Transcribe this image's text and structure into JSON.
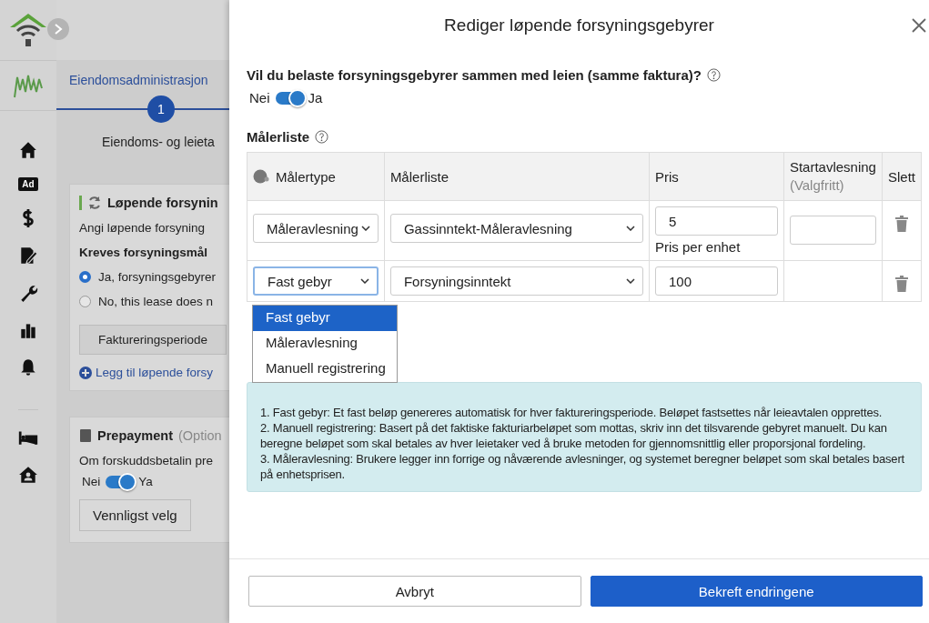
{
  "sidebar": {
    "items": [
      {
        "kind": "home"
      },
      {
        "kind": "ad",
        "label": "Ad"
      },
      {
        "kind": "dollar"
      },
      {
        "kind": "edit"
      },
      {
        "kind": "wrench"
      },
      {
        "kind": "chart"
      },
      {
        "kind": "bell"
      },
      {
        "kind": "bed"
      },
      {
        "kind": "house"
      }
    ]
  },
  "background": {
    "breadcrumb": "Eiendomsadministrasjon",
    "step_number": "1",
    "step_label": "Eiendoms- og leieta",
    "card_title": "Løpende forsynin",
    "card_intro": "Angi løpende forsyning",
    "question": "Kreves forsyningsmål",
    "options": [
      {
        "label": "Ja, forsyningsgebyrer",
        "selected": true
      },
      {
        "label": "No, this lease does n",
        "selected": false
      }
    ],
    "period_button": "Faktureringsperiode",
    "add_link": "Legg til løpende forsy",
    "prepay_title": "Prepayment",
    "prepay_optional": "(Option",
    "prepay_question": "Om forskuddsbetalin pre",
    "prepay_toggle": {
      "off_label": "Nei",
      "on_label": "Ya",
      "on": true
    },
    "prepay_select": "Vennligst velg"
  },
  "dialog": {
    "title": "Rediger løpende forsyningsgebyrer",
    "question": "Vil du belaste forsyningsgebyrer sammen med leien (samme faktura)?",
    "toggle": {
      "off_label": "Nei",
      "on_label": "Ja",
      "on": true
    },
    "list_title": "Målerliste",
    "columns": [
      "Målertype",
      "Målerliste",
      "Pris",
      "Startavlesning",
      "Slett"
    ],
    "column_note": "(Valgfritt)",
    "rows": [
      {
        "type": "Måleravlesning",
        "meter": "Gassinntekt-Måleravlesning",
        "price": "5",
        "price_note": "Pris per enhet",
        "focused": false
      },
      {
        "type": "Fast gebyr",
        "meter": "Forsyningsinntekt",
        "price": "100",
        "focused": true
      }
    ],
    "dropdown": [
      {
        "label": "Fast gebyr",
        "selected": true
      },
      {
        "label": "Måleravlesning",
        "selected": false
      },
      {
        "label": "Manuell registrering",
        "selected": false
      }
    ],
    "info": [
      "1. Fast gebyr: Et fast beløp genereres automatisk for hver faktureringsperiode. Beløpet fastsettes når leieavtalen opprettes.",
      "2. Manuell registrering: Basert på det faktiske fakturiarbeløpet som mottas, skriv inn det tilsvarende gebyret manuelt. Du kan beregne beløpet som skal betales av hver leietaker ved å bruke metoden for gjennomsnittlig eller proporsjonal fordeling.",
      "3. Måleravlesning: Brukere legger inn forrige og nåværende avlesninger, og systemet beregner beløpet som skal betales basert på enhetsprisen."
    ],
    "cancel": "Avbryt",
    "confirm": "Bekreft endringene"
  }
}
